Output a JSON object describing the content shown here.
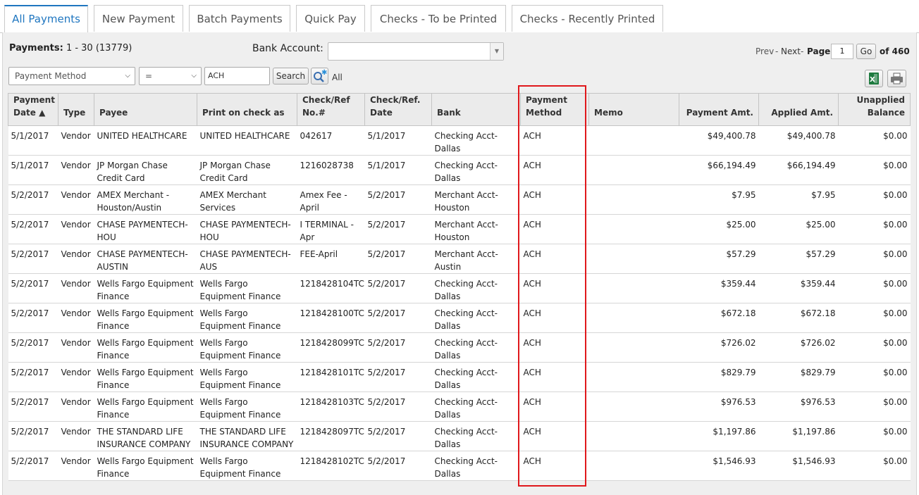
{
  "tabs": [
    {
      "label": "All Payments"
    },
    {
      "label": "New Payment"
    },
    {
      "label": "Batch Payments"
    },
    {
      "label": "Quick Pay"
    },
    {
      "label": "Checks - To be Printed"
    },
    {
      "label": "Checks - Recently Printed"
    }
  ],
  "summary": {
    "label": "Payments:",
    "range": "1 - 30 (13779)"
  },
  "bank": {
    "label": "Bank Account:",
    "value": ""
  },
  "pager": {
    "prev": "Prev",
    "sep1": "-",
    "next": "Next",
    "sep2": "-",
    "page_label": "Page",
    "page_value": "1",
    "go": "Go",
    "of_label": "of 460"
  },
  "filter": {
    "field": "Payment Method",
    "operator": "=",
    "value": "ACH",
    "search_label": "Search",
    "all_label": "All"
  },
  "columns": [
    {
      "label": "Payment Date ▲"
    },
    {
      "label": "Type"
    },
    {
      "label": "Payee"
    },
    {
      "label": "Print on check as"
    },
    {
      "label": "Check/Ref No.#"
    },
    {
      "label": "Check/Ref. Date"
    },
    {
      "label": "Bank"
    },
    {
      "label": "Payment Method"
    },
    {
      "label": "Memo"
    },
    {
      "label": "Payment Amt."
    },
    {
      "label": "Applied Amt."
    },
    {
      "label": "Unapplied Balance"
    }
  ],
  "rows": [
    {
      "date": "5/1/2017",
      "type": "Vendor",
      "payee": "UNITED HEALTHCARE",
      "print_as": "UNITED HEALTHCARE",
      "ref": "042617",
      "ref_date": "5/1/2017",
      "bank": "Checking Acct-Dallas",
      "method": "ACH",
      "memo": "",
      "amt": "$49,400.78",
      "applied": "$49,400.78",
      "unapplied": "$0.00"
    },
    {
      "date": "5/1/2017",
      "type": "Vendor",
      "payee": "JP Morgan Chase Credit Card",
      "print_as": "JP Morgan Chase Credit Card",
      "ref": "1216028738",
      "ref_date": "5/1/2017",
      "bank": "Checking Acct-Dallas",
      "method": "ACH",
      "memo": "",
      "amt": "$66,194.49",
      "applied": "$66,194.49",
      "unapplied": "$0.00"
    },
    {
      "date": "5/2/2017",
      "type": "Vendor",
      "payee": "AMEX Merchant - Houston/Austin",
      "print_as": "AMEX Merchant Services",
      "ref": "Amex Fee - April",
      "ref_date": "5/2/2017",
      "bank": "Merchant Acct-Houston",
      "method": "ACH",
      "memo": "",
      "amt": "$7.95",
      "applied": "$7.95",
      "unapplied": "$0.00"
    },
    {
      "date": "5/2/2017",
      "type": "Vendor",
      "payee": "CHASE PAYMENTECH-HOU",
      "print_as": "CHASE PAYMENTECH-HOU",
      "ref": "I TERMINAL - Apr",
      "ref_date": "5/2/2017",
      "bank": "Merchant Acct-Houston",
      "method": "ACH",
      "memo": "",
      "amt": "$25.00",
      "applied": "$25.00",
      "unapplied": "$0.00"
    },
    {
      "date": "5/2/2017",
      "type": "Vendor",
      "payee": "CHASE PAYMENTECH-AUSTIN",
      "print_as": "CHASE PAYMENTECH-AUS",
      "ref": "FEE-April",
      "ref_date": "5/2/2017",
      "bank": "Merchant Acct-Austin",
      "method": "ACH",
      "memo": "",
      "amt": "$57.29",
      "applied": "$57.29",
      "unapplied": "$0.00"
    },
    {
      "date": "5/2/2017",
      "type": "Vendor",
      "payee": "Wells Fargo Equipment Finance",
      "print_as": "Wells Fargo Equipment Finance",
      "ref": "1218428104TC",
      "ref_date": "5/2/2017",
      "bank": "Checking Acct-Dallas",
      "method": "ACH",
      "memo": "",
      "amt": "$359.44",
      "applied": "$359.44",
      "unapplied": "$0.00"
    },
    {
      "date": "5/2/2017",
      "type": "Vendor",
      "payee": "Wells Fargo Equipment Finance",
      "print_as": "Wells Fargo Equipment Finance",
      "ref": "1218428100TC",
      "ref_date": "5/2/2017",
      "bank": "Checking Acct-Dallas",
      "method": "ACH",
      "memo": "",
      "amt": "$672.18",
      "applied": "$672.18",
      "unapplied": "$0.00"
    },
    {
      "date": "5/2/2017",
      "type": "Vendor",
      "payee": "Wells Fargo Equipment Finance",
      "print_as": "Wells Fargo Equipment Finance",
      "ref": "1218428099TC",
      "ref_date": "5/2/2017",
      "bank": "Checking Acct-Dallas",
      "method": "ACH",
      "memo": "",
      "amt": "$726.02",
      "applied": "$726.02",
      "unapplied": "$0.00"
    },
    {
      "date": "5/2/2017",
      "type": "Vendor",
      "payee": "Wells Fargo Equipment Finance",
      "print_as": "Wells Fargo Equipment Finance",
      "ref": "1218428101TC",
      "ref_date": "5/2/2017",
      "bank": "Checking Acct-Dallas",
      "method": "ACH",
      "memo": "",
      "amt": "$829.79",
      "applied": "$829.79",
      "unapplied": "$0.00"
    },
    {
      "date": "5/2/2017",
      "type": "Vendor",
      "payee": "Wells Fargo Equipment Finance",
      "print_as": "Wells Fargo Equipment Finance",
      "ref": "1218428103TC",
      "ref_date": "5/2/2017",
      "bank": "Checking Acct-Dallas",
      "method": "ACH",
      "memo": "",
      "amt": "$976.53",
      "applied": "$976.53",
      "unapplied": "$0.00"
    },
    {
      "date": "5/2/2017",
      "type": "Vendor",
      "payee": "THE STANDARD LIFE INSURANCE COMPANY",
      "print_as": "THE STANDARD LIFE INSURANCE COMPANY",
      "ref": "1218428097TC",
      "ref_date": "5/2/2017",
      "bank": "Checking Acct-Dallas",
      "method": "ACH",
      "memo": "",
      "amt": "$1,197.86",
      "applied": "$1,197.86",
      "unapplied": "$0.00"
    },
    {
      "date": "5/2/2017",
      "type": "Vendor",
      "payee": "Wells Fargo Equipment Finance",
      "print_as": "Wells Fargo Equipment Finance",
      "ref": "1218428102TC",
      "ref_date": "5/2/2017",
      "bank": "Checking Acct-Dallas",
      "method": "ACH",
      "memo": "",
      "amt": "$1,546.93",
      "applied": "$1,546.93",
      "unapplied": "$0.00"
    }
  ],
  "colors": {
    "accent": "#1f76c0",
    "highlight": "#e0181c",
    "excel": "#1d7a3e"
  },
  "icons": {
    "search_options": "magnifier-star-icon",
    "excel": "excel-icon",
    "print": "printer-icon"
  }
}
